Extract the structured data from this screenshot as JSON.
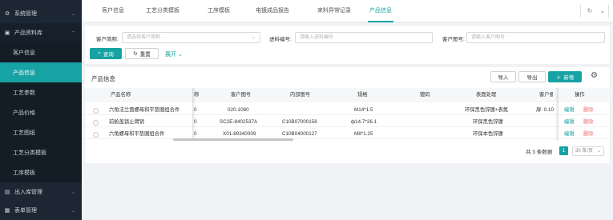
{
  "sidebar": {
    "items": [
      {
        "label": "系统管理",
        "icon": "gear-icon",
        "chevron": "⌄"
      },
      {
        "label": "产品资料库",
        "icon": "database-icon",
        "chevron": "⌃"
      },
      {
        "label": "出入库管理",
        "icon": "warehouse-icon",
        "chevron": "⌄"
      },
      {
        "label": "表单管理",
        "icon": "form-icon",
        "chevron": "⌄"
      }
    ],
    "subitems": [
      "客户信息",
      "产品信息",
      "工艺参数",
      "产品价格",
      "工艺图纸",
      "工艺分类模板",
      "工序模板"
    ]
  },
  "tabs": [
    "客户信息",
    "工艺分类模板",
    "工序模板",
    "电镀成品报告",
    "来料异常记录",
    "产品信息"
  ],
  "filter": {
    "customer_label": "客户简称:",
    "customer_placeholder": "请选择客户简称",
    "incoming_label": "进料编号:",
    "incoming_placeholder": "请输入进料编号",
    "drawing_label": "客户图号:",
    "drawing_placeholder": "请输入客户图号",
    "search_button": "查询",
    "reset_button": "重置",
    "expand_link": "展开"
  },
  "table": {
    "title": "产品信息",
    "import_button": "导入",
    "export_button": "导出",
    "add_button": "新增",
    "columns": [
      "产品名称",
      "称",
      "客户图号",
      "内部图号",
      "规格",
      "镀码",
      "表面处理",
      "客户要",
      "操作"
    ],
    "rows": [
      {
        "name": "六角法兰面螺母和平垫圈组合件",
        "abbr": "0",
        "customer_no": "020-1080",
        "internal_no": "",
        "spec": "M14*1.5",
        "code": "",
        "surface": "环保黑色锌镍+表氮",
        "req": "扉: 0.10",
        "edit": "编辑",
        "delete": "删除"
      },
      {
        "name": "前舱盖锁止臂销",
        "abbr": "0",
        "customer_no": "SC2E-8402537A",
        "internal_no": "C10B07000158",
        "spec": "ф14.7*26.1",
        "code": "",
        "surface": "环保黑色锌镍",
        "req": "",
        "edit": "编辑",
        "delete": "删除"
      },
      {
        "name": "六角螺母和平垫圈组合件",
        "abbr": "0",
        "customer_no": "X01-89340009",
        "internal_no": "C10B04000127",
        "spec": "M8*1.25",
        "code": "",
        "surface": "环保本色锌镍",
        "req": "",
        "edit": "编辑",
        "delete": "删除"
      }
    ]
  },
  "pagination": {
    "total": "共 3 条数据",
    "current_page": "1",
    "page_size": "30 条/页"
  },
  "colors": {
    "accent": "#17a2a3",
    "sidebar": "#1c2733",
    "danger": "#f56c6c"
  }
}
